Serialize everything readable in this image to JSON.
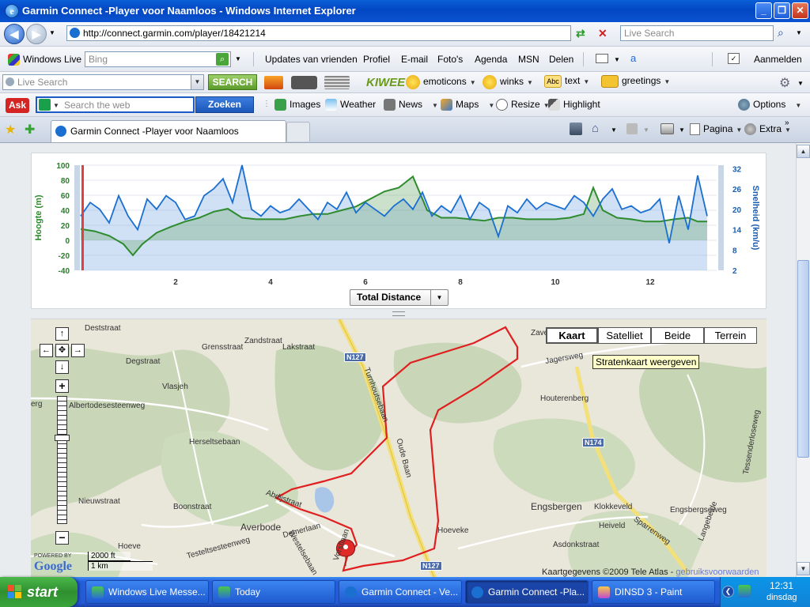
{
  "window": {
    "title": "Garmin Connect -Player voor Naamloos - Windows Internet Explorer"
  },
  "address": {
    "url": "http://connect.garmin.com/player/18421214",
    "search_placeholder": "Live Search"
  },
  "wlbar": {
    "brand": "Windows Live",
    "search_value": "Bing",
    "links": [
      "Updates van vrienden",
      "Profiel",
      "E-mail",
      "Foto's",
      "Agenda",
      "MSN",
      "Delen"
    ],
    "signin": "Aanmelden"
  },
  "livebar": {
    "search_placeholder": "Live Search",
    "search_button": "SEARCH",
    "brand": "KIWEE",
    "items": [
      "emoticons",
      "winks",
      "text",
      "greetings"
    ]
  },
  "askbar": {
    "brand": "Ask",
    "placeholder": "Search the web",
    "button": "Zoeken",
    "items": [
      "Images",
      "Weather",
      "News",
      "Maps",
      "Resize",
      "Highlight"
    ],
    "options": "Options"
  },
  "tabs": {
    "active": "Garmin Connect -Player voor Naamloos",
    "cmd_page": "Pagina",
    "cmd_extra": "Extra"
  },
  "chart": {
    "left_label": "Hoogte (m)",
    "right_label": "Snelheid (km/u)",
    "left_ticks": [
      "100",
      "80",
      "60",
      "40",
      "20",
      "0",
      "-20",
      "-40"
    ],
    "right_ticks": [
      "32",
      "26",
      "20",
      "14",
      "8",
      "2"
    ],
    "x_ticks": [
      "2",
      "4",
      "6",
      "8",
      "10",
      "12"
    ],
    "xaxis_select": "Total Distance"
  },
  "chart_data": {
    "type": "line",
    "xlabel": "Total Distance",
    "xlim": [
      0,
      13.4
    ],
    "series": [
      {
        "name": "Hoogte (m)",
        "axis": "left",
        "ylim": [
          -40,
          100
        ],
        "color": "#2e8b2e",
        "x": [
          0,
          0.3,
          0.6,
          0.9,
          1.1,
          1.3,
          1.6,
          1.9,
          2.2,
          2.5,
          2.8,
          3.1,
          3.4,
          3.7,
          4.0,
          4.3,
          4.6,
          4.9,
          5.2,
          5.5,
          5.8,
          6.1,
          6.4,
          6.7,
          7.0,
          7.3,
          7.6,
          7.9,
          8.2,
          8.5,
          8.8,
          9.1,
          9.4,
          9.7,
          10.0,
          10.3,
          10.6,
          10.8,
          11.0,
          11.3,
          11.6,
          11.9,
          12.2,
          12.5,
          12.8,
          13.0,
          13.2
        ],
        "y": [
          15,
          12,
          6,
          -5,
          -20,
          -5,
          10,
          18,
          25,
          30,
          38,
          42,
          30,
          28,
          28,
          28,
          32,
          35,
          35,
          40,
          45,
          55,
          65,
          70,
          85,
          40,
          30,
          30,
          28,
          26,
          30,
          30,
          28,
          28,
          28,
          30,
          35,
          70,
          40,
          30,
          28,
          25,
          25,
          28,
          30,
          25,
          25
        ]
      },
      {
        "name": "Snelheid (km/u)",
        "axis": "right",
        "ylim": [
          2,
          33
        ],
        "color": "#1a6fd0",
        "x": [
          0,
          0.2,
          0.4,
          0.6,
          0.8,
          1.0,
          1.2,
          1.4,
          1.6,
          1.8,
          2.0,
          2.2,
          2.4,
          2.6,
          2.8,
          3.0,
          3.2,
          3.4,
          3.6,
          3.8,
          4.0,
          4.2,
          4.4,
          4.6,
          4.8,
          5.0,
          5.2,
          5.4,
          5.6,
          5.8,
          6.0,
          6.2,
          6.4,
          6.6,
          6.8,
          7.0,
          7.2,
          7.4,
          7.6,
          7.8,
          8.0,
          8.2,
          8.4,
          8.6,
          8.8,
          9.0,
          9.2,
          9.4,
          9.6,
          9.8,
          10.0,
          10.2,
          10.4,
          10.6,
          10.8,
          11.0,
          11.2,
          11.4,
          11.6,
          11.8,
          12.0,
          12.2,
          12.4,
          12.6,
          12.8,
          13.0,
          13.2
        ],
        "y": [
          18,
          22,
          20,
          16,
          24,
          18,
          14,
          23,
          20,
          24,
          22,
          17,
          18,
          24,
          26,
          29,
          22,
          33,
          20,
          18,
          21,
          19,
          20,
          23,
          20,
          17,
          22,
          20,
          25,
          19,
          22,
          20,
          18,
          21,
          23,
          20,
          25,
          18,
          21,
          19,
          24,
          17,
          22,
          20,
          12,
          21,
          19,
          23,
          20,
          22,
          21,
          20,
          24,
          22,
          18,
          23,
          26,
          20,
          21,
          19,
          20,
          23,
          10,
          24,
          14,
          30,
          18
        ]
      }
    ]
  },
  "map": {
    "types": [
      "Kaart",
      "Satelliet",
      "Beide",
      "Terrein"
    ],
    "tooltip": "Stratenkaart weergeven",
    "labels": [
      "Deststraat",
      "Degstraat",
      "Grensstraat",
      "Zandstraat",
      "Lakstraat",
      "Albertodesesteenweg",
      "Vlasjeh",
      "Herseltsebaan",
      "Nieuwstraat",
      "Boonstraat",
      "Averbode",
      "Abdijstraat",
      "Demerlaan",
      "Westelsebaan",
      "Vorstlaan",
      "Turnhoutsebaan",
      "Oude Baan",
      "Houterenberg",
      "Jagersweg",
      "Engsbergseweg",
      "Engsbergen",
      "Klokkeveld",
      "Heiveld",
      "Asdonkstraat",
      "Sparrenweg",
      "Langebeide",
      "Tessenderloseweg",
      "Zavel",
      "Hoeve",
      "Testeltsesteenweg",
      "Hoeveke",
      "erg"
    ],
    "roads": [
      "N127",
      "N174",
      "N127"
    ],
    "scale": [
      "2000 ft",
      "1 km"
    ],
    "powered": "POWERED BY",
    "google": "Google",
    "attrib": "Kaartgegevens ©2009 Tele Atlas -",
    "terms": "gebruiksvoorwaarden"
  },
  "taskbar": {
    "start": "start",
    "tasks": [
      "Windows Live Messe...",
      "Today",
      "Garmin Connect - Ve...",
      "Garmin Connect -Pla...",
      "DINSD 3 - Paint"
    ],
    "clock": "12:31",
    "day": "dinsdag"
  }
}
